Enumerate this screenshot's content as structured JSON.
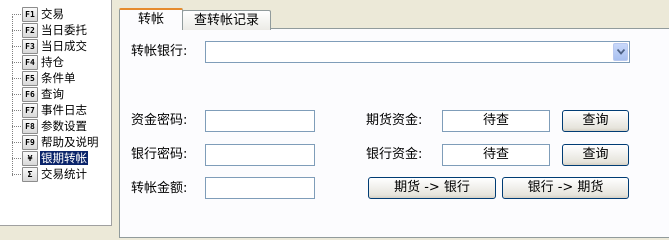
{
  "tree": {
    "items": [
      {
        "key": "F1",
        "label": "交易"
      },
      {
        "key": "F2",
        "label": "当日委托"
      },
      {
        "key": "F3",
        "label": "当日成交"
      },
      {
        "key": "F4",
        "label": "持仓"
      },
      {
        "key": "F5",
        "label": "条件单"
      },
      {
        "key": "F6",
        "label": "查询"
      },
      {
        "key": "F7",
        "label": "事件日志"
      },
      {
        "key": "F8",
        "label": "参数设置"
      },
      {
        "key": "F9",
        "label": "帮助及说明"
      },
      {
        "key": "¥",
        "label": "银期转帐"
      },
      {
        "key": "Σ",
        "label": "交易统计"
      }
    ],
    "selected_index": 9
  },
  "tabs": [
    {
      "label": "转帐"
    },
    {
      "label": "查转帐记录"
    }
  ],
  "form": {
    "bank_label": "转帐银行:",
    "bank_value": "",
    "fund_password_label": "资金密码:",
    "fund_password_value": "",
    "bank_password_label": "银行密码:",
    "bank_password_value": "",
    "amount_label": "转帐金额:",
    "amount_value": "",
    "futures_funds_label": "期货资金:",
    "futures_funds_value": "待查",
    "bank_funds_label": "银行资金:",
    "bank_funds_value": "待查",
    "query_label": "查询",
    "futures_to_bank_label": "期货 -> 银行",
    "bank_to_futures_label": "银行 -> 期货"
  },
  "colors": {
    "window_bg": "#ece9d8",
    "selection": "#0a246a",
    "input_border": "#7f9db9",
    "active_tab_accent": "#e68b2c"
  }
}
